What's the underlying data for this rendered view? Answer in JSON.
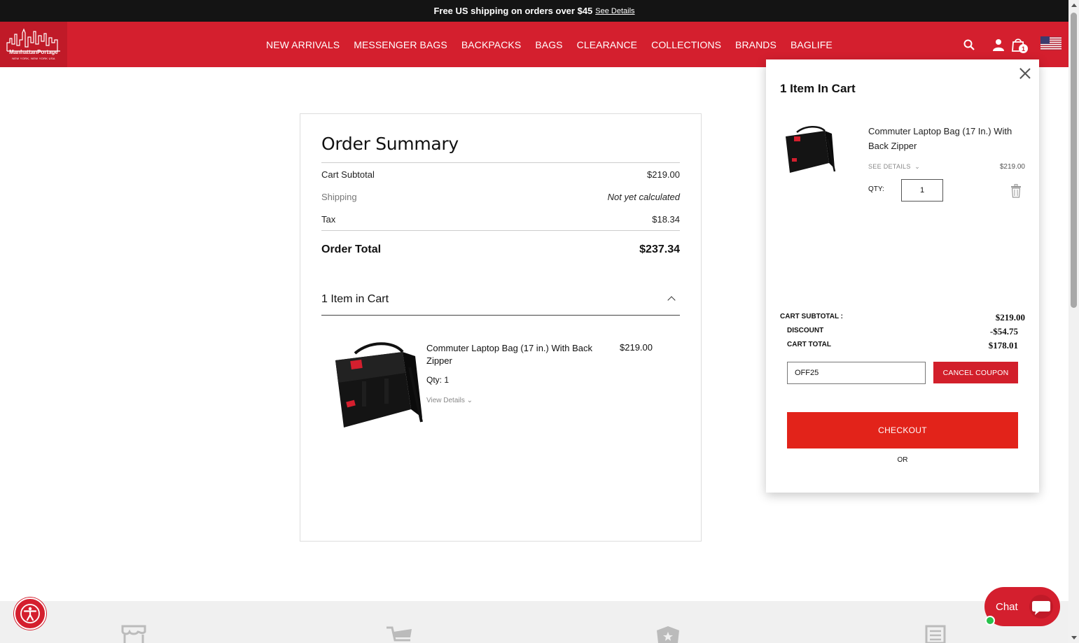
{
  "announcement": {
    "text": "Free US shipping on orders over $45",
    "link": "See Details"
  },
  "brand": {
    "name": "ManhattanPortage",
    "tagline": "NEW YORK, NEW YORK USA",
    "color": "#d41f2e"
  },
  "nav": {
    "items": [
      "NEW ARRIVALS",
      "MESSENGER BAGS",
      "BACKPACKS",
      "BAGS",
      "CLEARANCE",
      "COLLECTIONS",
      "BRANDS",
      "BAGLIFE"
    ]
  },
  "header_icons": {
    "search": "search-icon",
    "account": "user-icon",
    "cart": "shopping-bag-icon",
    "cart_count": "1",
    "region": "us-flag-icon"
  },
  "summary": {
    "title": "Order Summary",
    "subtotal_label": "Cart Subtotal",
    "subtotal_value": "$219.00",
    "shipping_label": "Shipping",
    "shipping_value": "Not yet calculated",
    "tax_label": "Tax",
    "tax_value": "$18.34",
    "total_label": "Order Total",
    "total_value": "$237.34",
    "items_heading": "1 Item in Cart",
    "item": {
      "name": "Commuter Laptop Bag (17 in.) With Back Zipper",
      "qty": "Qty: 1",
      "details": "View Details",
      "price": "$219.00"
    }
  },
  "minicart": {
    "title": "1 Item In Cart",
    "item": {
      "name": "Commuter Laptop Bag (17 In.) With Back Zipper",
      "see_details": "SEE DETAILS",
      "price": "$219.00",
      "qty_label": "QTY:",
      "qty_value": "1"
    },
    "subtotal_label": "CART SUBTOTAL :",
    "subtotal_value": "$219.00",
    "discount_label": "DISCOUNT",
    "discount_value": "-$54.75",
    "total_label": "CART TOTAL",
    "total_value": "$178.01",
    "coupon_code": "OFF25",
    "cancel_coupon": "CANCEL COUPON",
    "checkout": "CHECKOUT",
    "or": "OR"
  },
  "chat": {
    "label": "Chat"
  }
}
